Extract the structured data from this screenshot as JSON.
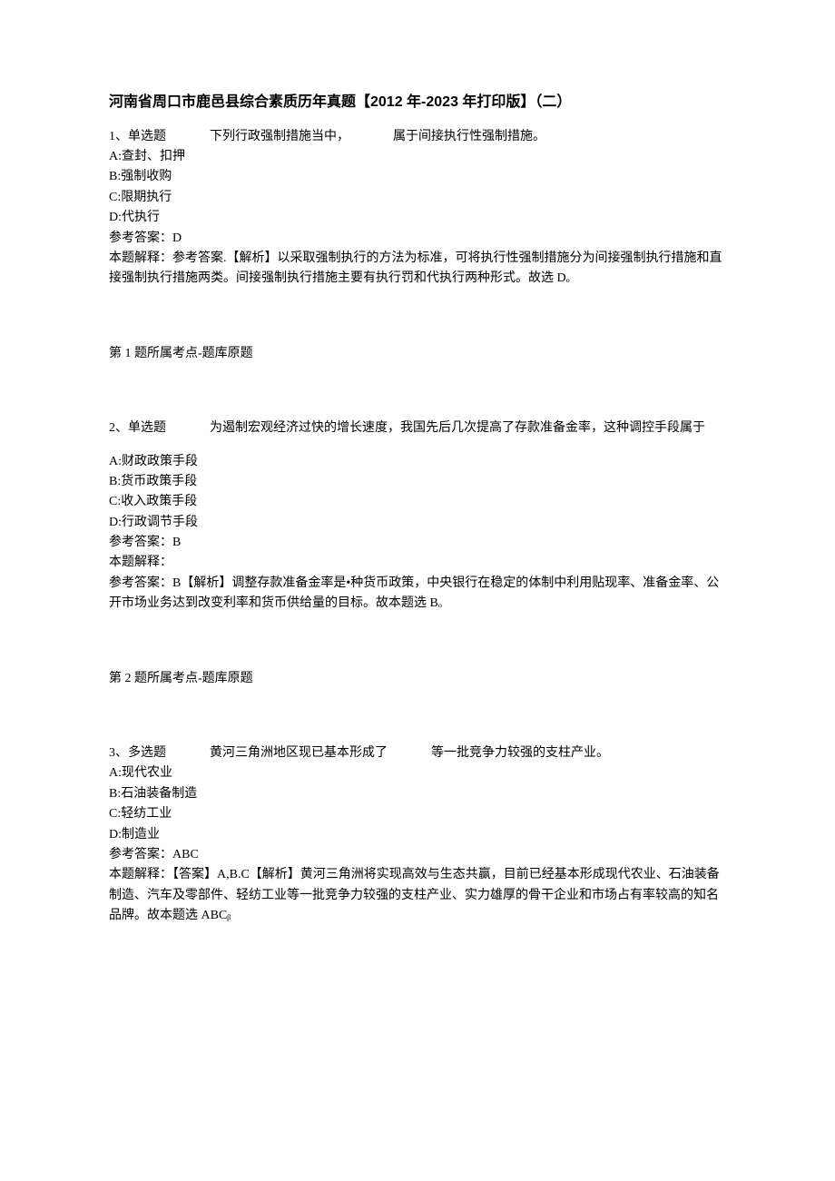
{
  "title": "河南省周口市鹿邑县综合素质历年真题【2012 年-2023 年打印版】（二）",
  "q1": {
    "header_prefix": "1、单选题",
    "header_text_a": "下列行政强制措施当中，",
    "header_text_b": "属于间接执行性强制措施。",
    "optA": "A:查封、扣押",
    "optB": "B:强制收购",
    "optC": "C:限期执行",
    "optD": "D:代执行",
    "ans_label": "参考答案：D",
    "explain": "本题解释：参考答案.【解析】以采取强制执行的方法为标准，可将执行性强制措施分为间接强制执行措施和直接强制执行措施两类。间接强制执行措施主要有执行罚和代执行两种形式。故选 Dₒ",
    "footer": "第 1 题所属考点-题库原题"
  },
  "q2": {
    "header_prefix": "2、单选题",
    "header_text": "为遏制宏观经济过快的增长速度，我国先后几次提高了存款准备金率，这种调控手段属于",
    "optA": "A:财政政策手段",
    "optB": "B:货币政策手段",
    "optC": "C:收入政策手段",
    "optD": "D:行政调节手段",
    "ans_label": "参考答案：B",
    "explain_label": "本题解释：",
    "explain": "参考答案：B【解析】调整存款准备金率是•种货币政策，中央银行在稳定的体制中利用贴现率、准备金率、公开市场业务达到改变利率和货币供给量的目标。故本题选 Bₒ",
    "footer": "第 2 题所属考点-题库原题"
  },
  "q3": {
    "header_prefix": "3、多选题",
    "header_text_a": "黄河三角洲地区现已基本形成了",
    "header_text_b": "等一批竞争力较强的支柱产业。",
    "optA": "A:现代农业",
    "optB": "B:石油装备制造",
    "optC": "C:轻纺工业",
    "optD": "D:制造业",
    "ans_label": "参考答案：ABC",
    "explain": "本题解释：【答案】A,B.C【解析】黄河三角洲将实现高效与生态共赢，目前已经基本形成现代农业、石油装备制造、汽车及零部件、轻纺工业等一批竞争力较强的支柱产业、实力雄厚的骨干企业和市场占有率较高的知名品牌。故本题选 ABCᵦ"
  }
}
